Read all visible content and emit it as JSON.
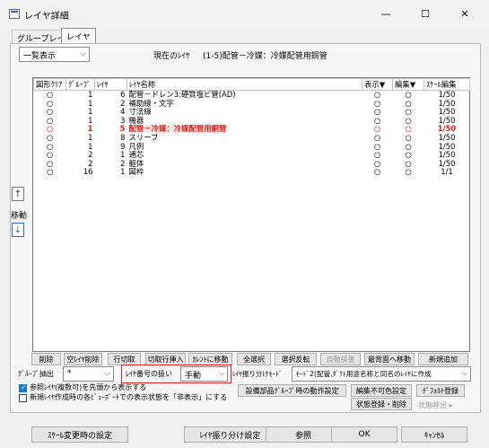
{
  "window": {
    "title": "レイヤ詳細",
    "minimize": "—",
    "maximize": "☐",
    "close": "✕"
  },
  "tabs": [
    "グループレイヤ",
    "レイヤ"
  ],
  "view_select": "一覧表示",
  "current_layer_label": "現在のﾚｲﾔ",
  "current_layer_value": "(1-5)配管－冷媒：冷媒配管用銅管",
  "columns": [
    "図形ｸﾘｱ",
    "ｸﾞﾙｰﾌﾟ",
    "ﾚｲﾔ",
    "ﾚｲﾔ名称",
    "表示▼",
    "編集▼",
    "ｽｹｰﾙ編集"
  ],
  "rows": [
    {
      "clear": "○",
      "group": "1",
      "layer": "6",
      "name": "配管－ドレン3:硬質塩ビ管(AD)",
      "show": "○",
      "edit": "○",
      "scale": "1/50",
      "hl": false
    },
    {
      "clear": "○",
      "group": "1",
      "layer": "2",
      "name": "補助線・文字",
      "show": "○",
      "edit": "○",
      "scale": "1/50",
      "hl": false
    },
    {
      "clear": "○",
      "group": "1",
      "layer": "4",
      "name": "寸法線",
      "show": "○",
      "edit": "○",
      "scale": "1/50",
      "hl": false
    },
    {
      "clear": "○",
      "group": "1",
      "layer": "3",
      "name": "機器",
      "show": "○",
      "edit": "○",
      "scale": "1/50",
      "hl": false
    },
    {
      "clear": "○",
      "group": "1",
      "layer": "5",
      "name": "配管－冷媒：冷媒配管用銅管",
      "show": "○",
      "edit": "○",
      "scale": "1/50",
      "hl": true
    },
    {
      "clear": "○",
      "group": "1",
      "layer": "8",
      "name": "スリーブ",
      "show": "○",
      "edit": "○",
      "scale": "1/50",
      "hl": false
    },
    {
      "clear": "○",
      "group": "1",
      "layer": "9",
      "name": "凡例",
      "show": "○",
      "edit": "○",
      "scale": "1/50",
      "hl": false
    },
    {
      "clear": "○",
      "group": "2",
      "layer": "1",
      "name": "通芯",
      "show": "○",
      "edit": "○",
      "scale": "1/50",
      "hl": false
    },
    {
      "clear": "○",
      "group": "2",
      "layer": "2",
      "name": "躯体",
      "show": "○",
      "edit": "○",
      "scale": "1/50",
      "hl": false
    },
    {
      "clear": "○",
      "group": "16",
      "layer": "1",
      "name": "図枠",
      "show": "○",
      "edit": "○",
      "scale": "1/1",
      "hl": false
    }
  ],
  "move": {
    "up": "↑",
    "label": "移動",
    "down": "↓"
  },
  "buttons_row": [
    {
      "label": "削除",
      "enabled": true
    },
    {
      "label": "空ﾚｲﾔ削除",
      "enabled": true
    },
    {
      "label": "行切取",
      "enabled": true
    },
    {
      "label": "切取行挿入",
      "enabled": true
    },
    {
      "label": "ｶﾚﾝﾄに移動",
      "enabled": true
    },
    {
      "label": "全選択",
      "enabled": true
    },
    {
      "label": "選択反転",
      "enabled": true
    },
    {
      "label": "自動採番",
      "enabled": false
    },
    {
      "label": "最背面へ移動",
      "enabled": true
    },
    {
      "label": "新規追加",
      "enabled": true
    }
  ],
  "group_extract_label": "ｸﾞﾙｰﾌﾟ抽出",
  "group_extract_value": "*",
  "layer_number_label": "ﾚｲﾔ番号の扱い",
  "layer_number_value": "手動",
  "layer_split_label": "ﾚｲﾔ振り分けﾓｰﾄﾞ",
  "layer_split_value": "ﾓｰﾄﾞ2(配管,ﾀﾞｸﾄ用途名称と同名のﾚｲﾔに作成",
  "check_ref_layer": {
    "label": "参照ﾚｲﾔ(複数可)を先頭から表示する",
    "checked": true
  },
  "check_new_layer": {
    "label": "新規ﾚｲﾔ作成時の各ﾋﾞｭｰﾎﾟｰﾄでの表示状態を「非表示」にする",
    "checked": false
  },
  "btn_group_action": "設備部品ｸﾞﾙｰﾌﾟ時の動作設定",
  "btn_edit_color": "編集不可色設定",
  "btn_default_register": "ﾃﾞﾌｫﾙﾄ登録",
  "btn_state_register": "状態登録・削除",
  "btn_state_call": "状態呼出 ▸",
  "footer": [
    "ｽｹｰﾙ変更時の設定",
    "ﾚｲﾔ振り分け設定",
    "参照",
    "OK",
    "ｷｬﾝｾﾙ"
  ],
  "colors": {
    "highlight_red": "#e0201c",
    "checkbox_blue": "#1976d2"
  }
}
